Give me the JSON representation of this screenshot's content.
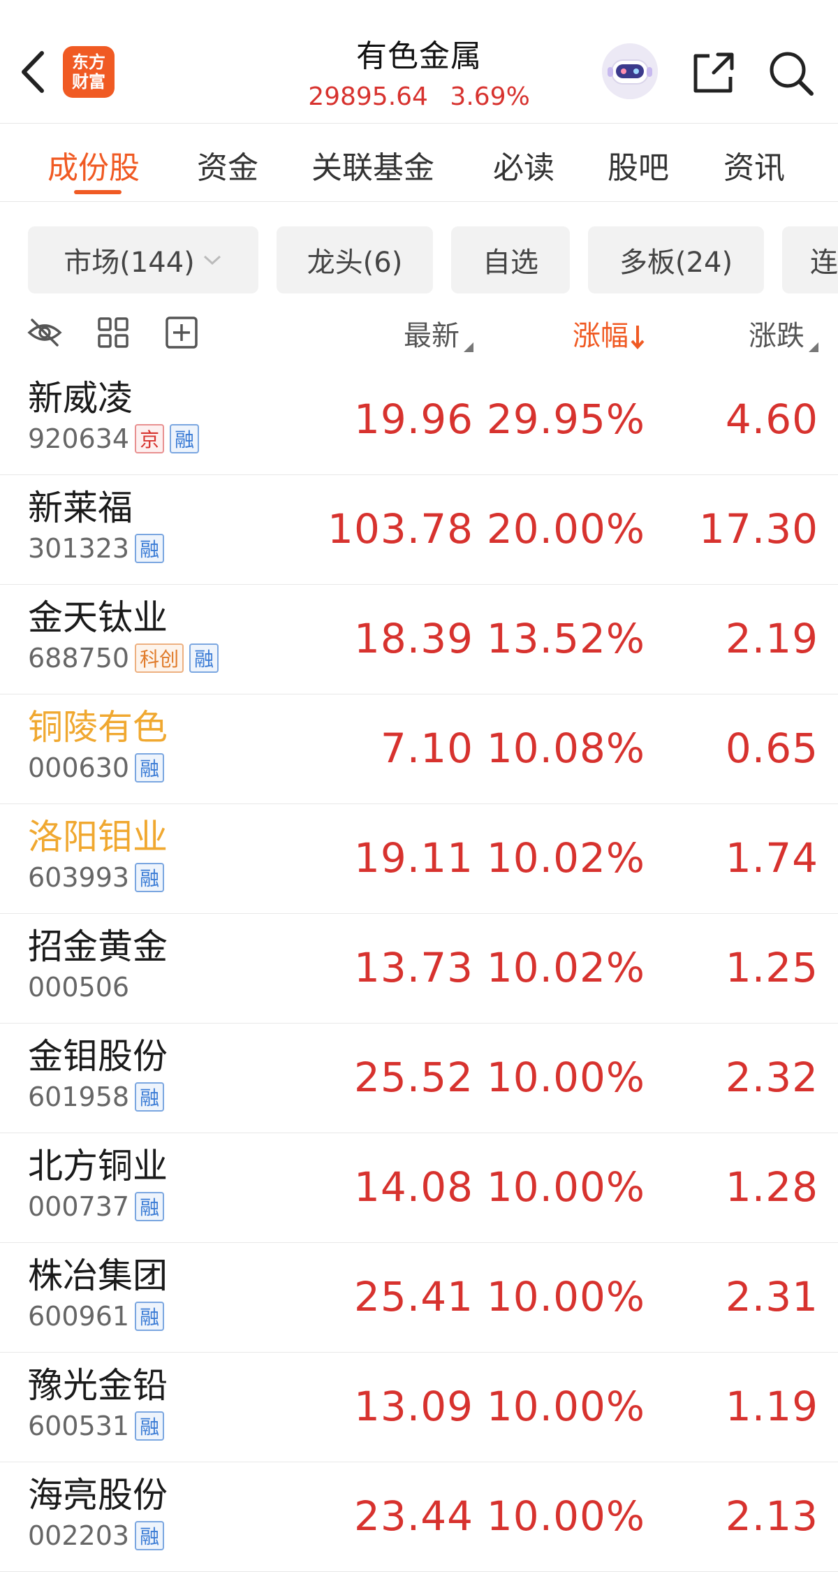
{
  "header": {
    "back_label": "返回",
    "logo_line1": "东方",
    "logo_line2": "财富",
    "title": "有色金属",
    "index_value": "29895.64",
    "index_change": "3.69%"
  },
  "tabs": [
    {
      "label": "成份股",
      "active": true
    },
    {
      "label": "资金"
    },
    {
      "label": "关联基金"
    },
    {
      "label": "必读"
    },
    {
      "label": "股吧"
    },
    {
      "label": "资讯"
    }
  ],
  "chips": [
    {
      "label": "市场(144)"
    },
    {
      "label": "龙头(6)"
    },
    {
      "label": "自选"
    },
    {
      "label": "多板(24)"
    },
    {
      "label": "连"
    }
  ],
  "columns": {
    "latest": "最新",
    "pct": "涨幅",
    "chg": "涨跌"
  },
  "colors": {
    "accent": "#f05a23",
    "up": "#d7322e",
    "highlight_name": "#f0a830"
  },
  "rows": [
    {
      "name": "新威凌",
      "code": "920634",
      "tags": [
        "京",
        "融"
      ],
      "latest": "19.96",
      "pct": "29.95%",
      "chg": "4.60",
      "highlight": false
    },
    {
      "name": "新莱福",
      "code": "301323",
      "tags": [
        "融"
      ],
      "latest": "103.78",
      "pct": "20.00%",
      "chg": "17.30",
      "highlight": false
    },
    {
      "name": "金天钛业",
      "code": "688750",
      "tags": [
        "科创",
        "融"
      ],
      "latest": "18.39",
      "pct": "13.52%",
      "chg": "2.19",
      "highlight": false
    },
    {
      "name": "铜陵有色",
      "code": "000630",
      "tags": [
        "融"
      ],
      "latest": "7.10",
      "pct": "10.08%",
      "chg": "0.65",
      "highlight": true
    },
    {
      "name": "洛阳钼业",
      "code": "603993",
      "tags": [
        "融"
      ],
      "latest": "19.11",
      "pct": "10.02%",
      "chg": "1.74",
      "highlight": true
    },
    {
      "name": "招金黄金",
      "code": "000506",
      "tags": [],
      "latest": "13.73",
      "pct": "10.02%",
      "chg": "1.25",
      "highlight": false
    },
    {
      "name": "金钼股份",
      "code": "601958",
      "tags": [
        "融"
      ],
      "latest": "25.52",
      "pct": "10.00%",
      "chg": "2.32",
      "highlight": false
    },
    {
      "name": "北方铜业",
      "code": "000737",
      "tags": [
        "融"
      ],
      "latest": "14.08",
      "pct": "10.00%",
      "chg": "1.28",
      "highlight": false
    },
    {
      "name": "株冶集团",
      "code": "600961",
      "tags": [
        "融"
      ],
      "latest": "25.41",
      "pct": "10.00%",
      "chg": "2.31",
      "highlight": false
    },
    {
      "name": "豫光金铅",
      "code": "600531",
      "tags": [
        "融"
      ],
      "latest": "13.09",
      "pct": "10.00%",
      "chg": "1.19",
      "highlight": false
    },
    {
      "name": "海亮股份",
      "code": "002203",
      "tags": [
        "融"
      ],
      "latest": "23.44",
      "pct": "10.00%",
      "chg": "2.13",
      "highlight": false
    }
  ]
}
